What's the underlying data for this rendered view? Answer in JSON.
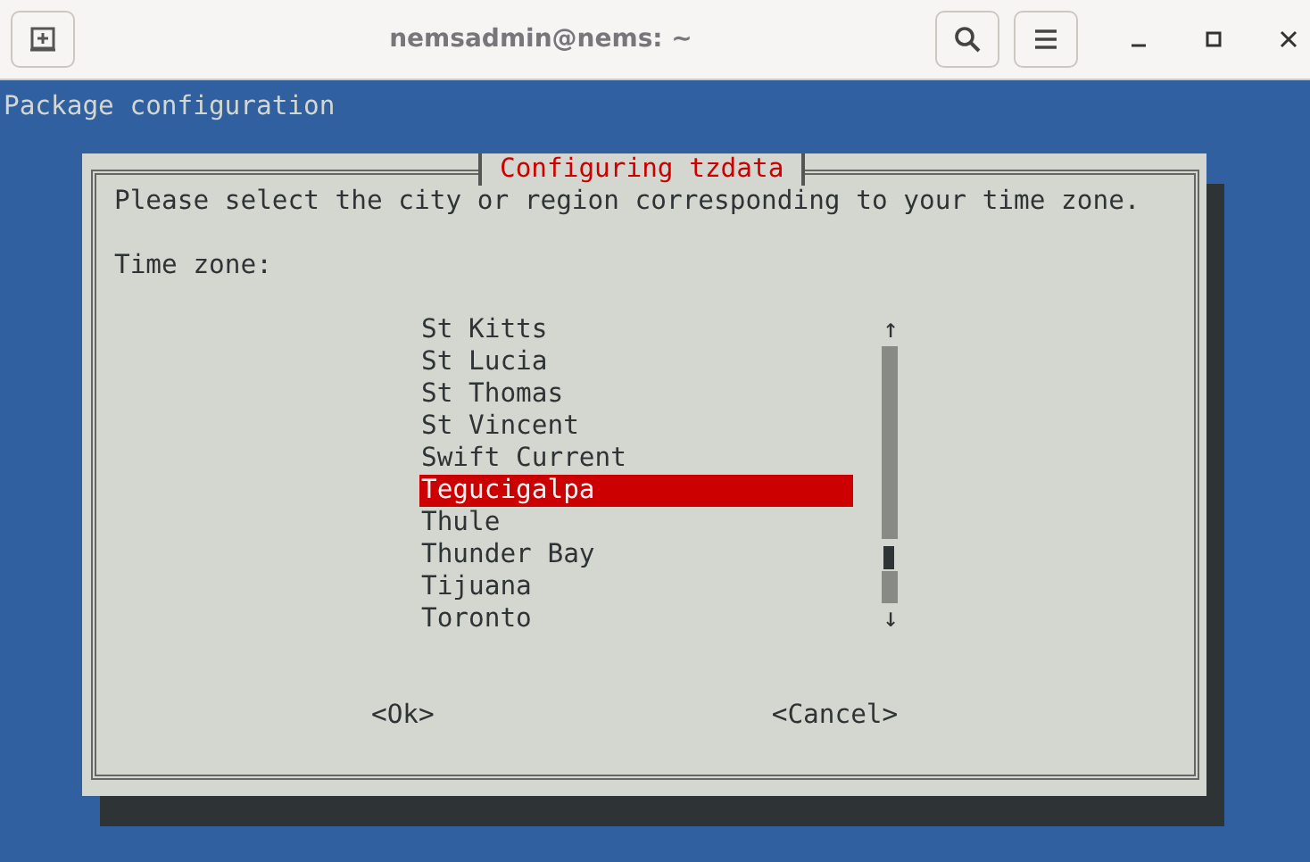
{
  "window": {
    "title": "nemsadmin@nems: ~"
  },
  "terminal": {
    "header": "Package configuration"
  },
  "dialog": {
    "title": "Configuring tzdata",
    "prompt": "Please select the city or region corresponding to your time zone.",
    "label": "Time zone:",
    "items": [
      {
        "label": "St Kitts",
        "selected": false
      },
      {
        "label": "St Lucia",
        "selected": false
      },
      {
        "label": "St Thomas",
        "selected": false
      },
      {
        "label": "St Vincent",
        "selected": false
      },
      {
        "label": "Swift Current",
        "selected": false
      },
      {
        "label": "Tegucigalpa",
        "selected": true
      },
      {
        "label": "Thule",
        "selected": false
      },
      {
        "label": "Thunder Bay",
        "selected": false
      },
      {
        "label": "Tijuana",
        "selected": false
      },
      {
        "label": "Toronto",
        "selected": false
      }
    ],
    "scroll_up": "↑",
    "scroll_down": "↓",
    "buttons": [
      "<Ok>",
      "<Cancel>"
    ]
  }
}
